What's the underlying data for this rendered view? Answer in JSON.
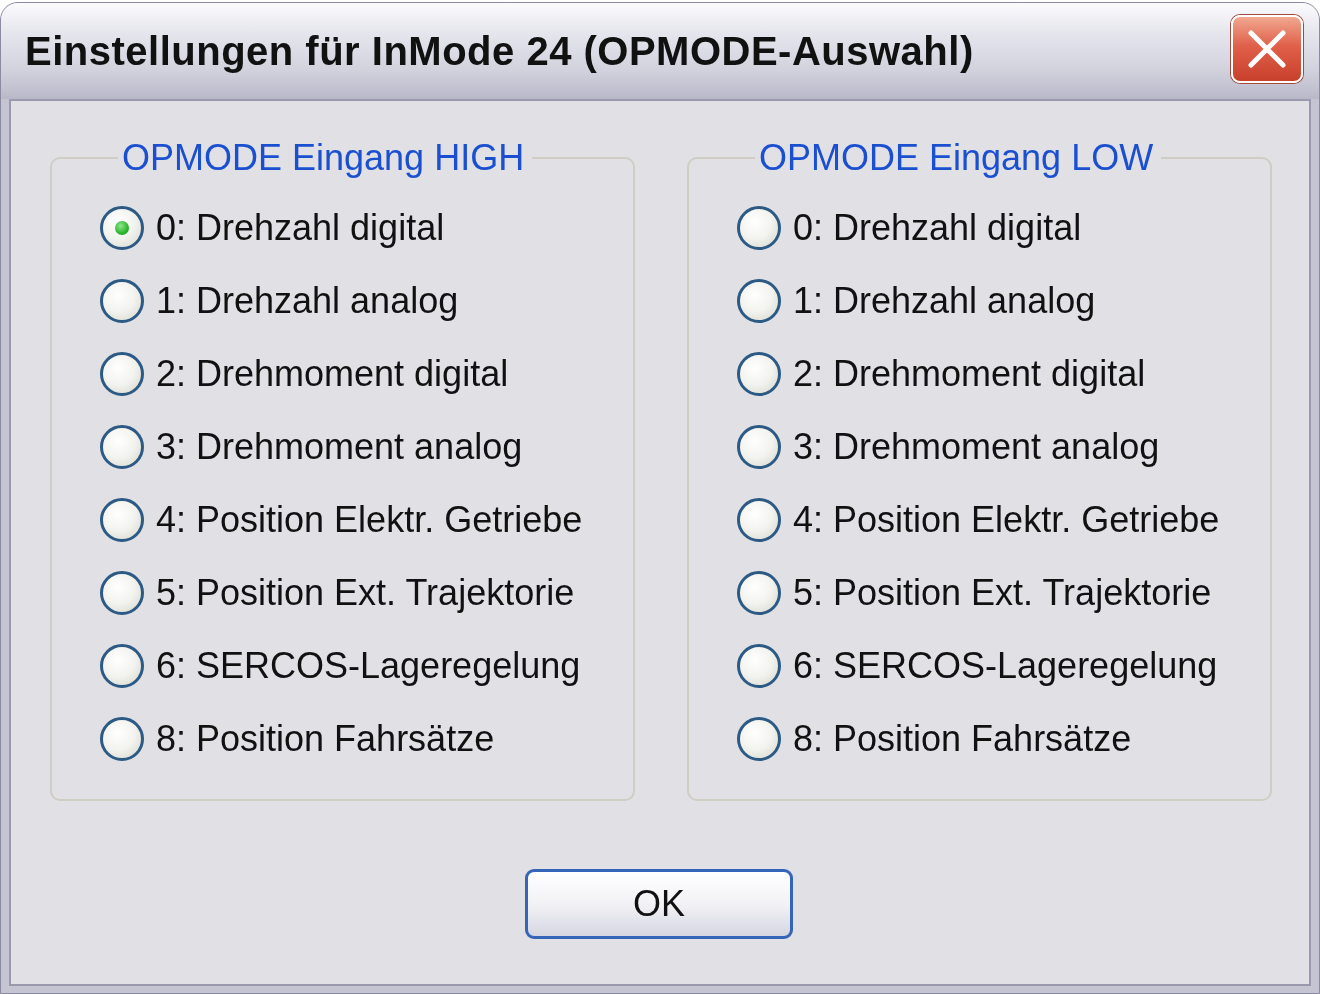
{
  "window": {
    "title": "Einstellungen für InMode 24 (OPMODE-Auswahl)"
  },
  "groups": [
    {
      "title": "OPMODE Eingang HIGH",
      "options": [
        {
          "label": "0: Drehzahl digital",
          "selected": true
        },
        {
          "label": "1: Drehzahl analog",
          "selected": false
        },
        {
          "label": "2: Drehmoment digital",
          "selected": false
        },
        {
          "label": "3: Drehmoment analog",
          "selected": false
        },
        {
          "label": "4: Position Elektr. Getriebe",
          "selected": false
        },
        {
          "label": "5: Position Ext. Trajektorie",
          "selected": false
        },
        {
          "label": "6: SERCOS-Lageregelung",
          "selected": false
        },
        {
          "label": "8: Position Fahrsätze",
          "selected": false
        }
      ]
    },
    {
      "title": "OPMODE Eingang LOW",
      "options": [
        {
          "label": "0: Drehzahl digital",
          "selected": false
        },
        {
          "label": "1: Drehzahl analog",
          "selected": false
        },
        {
          "label": "2: Drehmoment digital",
          "selected": false
        },
        {
          "label": "3: Drehmoment analog",
          "selected": false
        },
        {
          "label": "4: Position Elektr. Getriebe",
          "selected": false
        },
        {
          "label": "5: Position Ext. Trajektorie",
          "selected": false
        },
        {
          "label": "6: SERCOS-Lageregelung",
          "selected": false
        },
        {
          "label": "8: Position Fahrsätze",
          "selected": false
        }
      ]
    }
  ],
  "buttons": [
    {
      "label": "OK"
    }
  ]
}
